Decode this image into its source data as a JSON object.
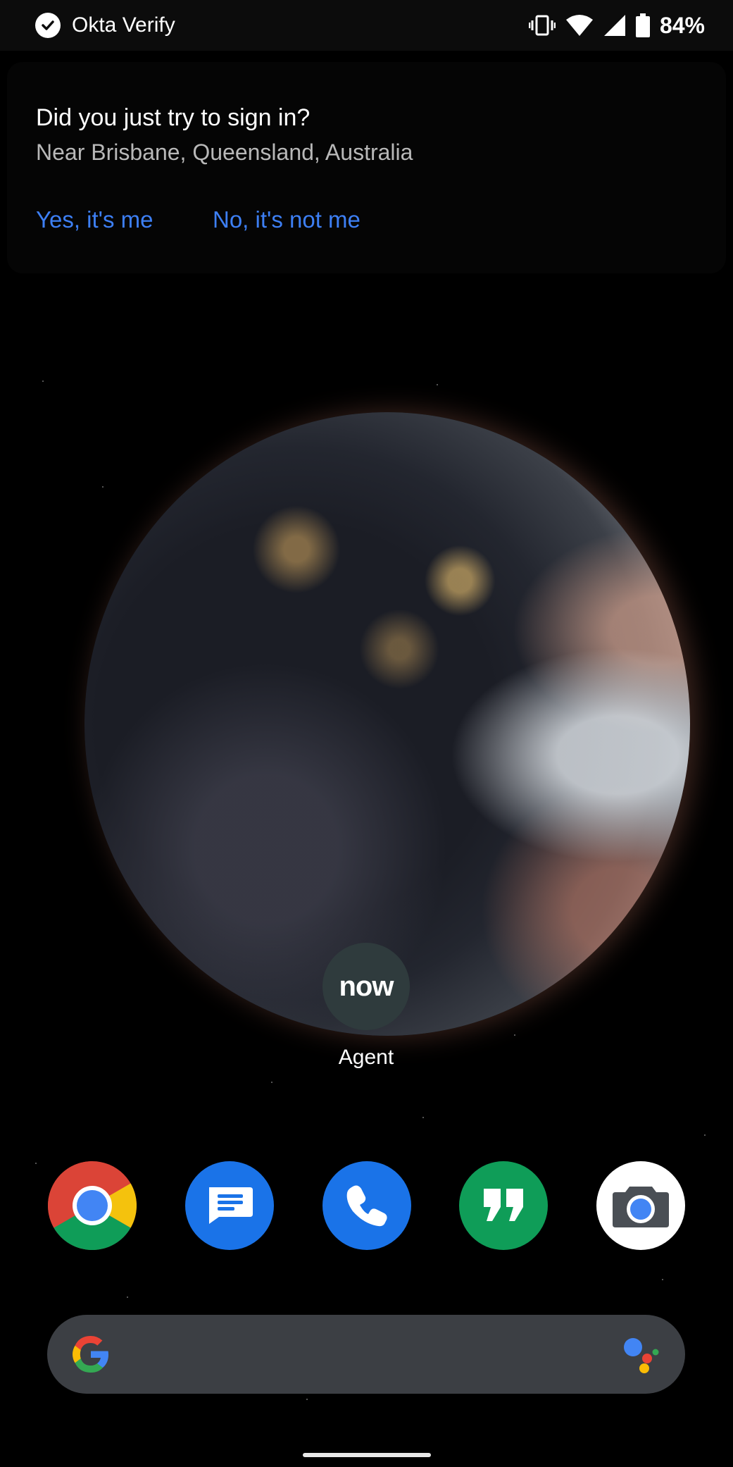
{
  "status_bar": {
    "app_name": "Okta Verify",
    "icons": [
      "okta-check-icon",
      "vibrate-icon",
      "wifi-icon",
      "cell-signal-icon",
      "battery-icon"
    ],
    "battery_percent": "84%"
  },
  "notification": {
    "title": "Did you just try to sign in?",
    "subtitle": "Near Brisbane, Queensland, Australia",
    "actions": {
      "yes_label": "Yes, it's me",
      "no_label": "No, it's not me"
    },
    "action_color": "#3d7ff4"
  },
  "home": {
    "app": {
      "icon_text": "now",
      "label": "Agent",
      "icon_color": "#2f3b3d"
    },
    "dock": [
      {
        "name": "chrome-icon",
        "color": "#ffffff"
      },
      {
        "name": "messages-icon",
        "color": "#1a73e8"
      },
      {
        "name": "phone-icon",
        "color": "#1a73e8"
      },
      {
        "name": "hangouts-icon",
        "color": "#0f9d58"
      },
      {
        "name": "camera-icon",
        "color": "#ffffff"
      }
    ]
  },
  "search_bar": {
    "icons": [
      "google-g-icon",
      "google-assistant-icon"
    ],
    "color": "#3c3f44"
  }
}
